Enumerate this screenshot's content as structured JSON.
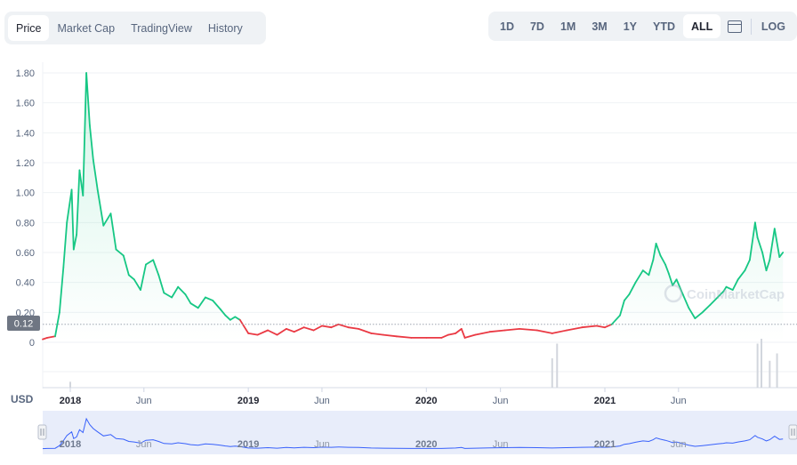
{
  "tabs": [
    "Price",
    "Market Cap",
    "TradingView",
    "History"
  ],
  "ranges": [
    "1D",
    "7D",
    "1M",
    "3M",
    "1Y",
    "YTD",
    "ALL"
  ],
  "log_label": "LOG",
  "currency_label": "USD",
  "watermark": "CoinMarketCap",
  "current_price_label": "0.12",
  "colors": {
    "up": "#16c784",
    "down": "#ea3943",
    "navigator": "#3861fb",
    "grid": "#eff2f5",
    "text": "#58667e"
  },
  "icons": {
    "calendar": "calendar-icon",
    "watermark_logo": "cmc-logo-icon"
  },
  "chart_data": {
    "type": "line",
    "title": "",
    "xlabel": "",
    "ylabel": "",
    "ylim": [
      0,
      1.8
    ],
    "yticks": [
      0,
      0.2,
      0.4,
      0.6,
      0.8,
      1.0,
      1.2,
      1.4,
      1.6,
      1.8
    ],
    "ytick_labels": [
      "0",
      "0.20",
      "0.40",
      "0.60",
      "0.80",
      "1.00",
      "1.20",
      "1.40",
      "1.60",
      "1.80"
    ],
    "xtick_labels": [
      "2018",
      "Jun",
      "2019",
      "Jun",
      "2020",
      "Jun",
      "2021",
      "Jun"
    ],
    "xtick_dates": [
      "2018-01-01",
      "2018-06-01",
      "2019-01-01",
      "2019-06-01",
      "2020-01-01",
      "2020-06-01",
      "2021-01-01",
      "2021-06-01"
    ],
    "reference_line": 0.12,
    "grid": true,
    "series": [
      {
        "x": [
          "2017-10-01",
          "2017-11-15",
          "2017-12-01",
          "2017-12-10",
          "2017-12-18",
          "2017-12-25",
          "2018-01-04",
          "2018-01-08",
          "2018-01-14",
          "2018-01-20",
          "2018-01-27",
          "2018-02-03",
          "2018-02-10",
          "2018-02-17",
          "2018-02-26",
          "2018-03-10",
          "2018-03-25",
          "2018-04-05",
          "2018-04-20",
          "2018-05-01",
          "2018-05-12",
          "2018-05-25",
          "2018-06-05",
          "2018-06-20",
          "2018-07-01",
          "2018-07-12",
          "2018-07-28",
          "2018-08-10",
          "2018-08-25",
          "2018-09-05",
          "2018-09-20",
          "2018-10-05",
          "2018-10-20",
          "2018-11-05",
          "2018-11-15",
          "2018-11-25",
          "2018-12-05",
          "2018-12-15",
          "2019-01-01",
          "2019-01-20",
          "2019-02-10",
          "2019-03-01",
          "2019-03-20",
          "2019-04-05",
          "2019-04-25",
          "2019-05-15",
          "2019-06-01",
          "2019-06-20",
          "2019-07-05",
          "2019-07-25",
          "2019-08-15",
          "2019-09-10",
          "2019-10-05",
          "2019-11-01",
          "2019-12-01",
          "2020-01-01",
          "2020-02-01",
          "2020-02-15",
          "2020-03-01",
          "2020-03-13",
          "2020-03-20",
          "2020-04-10",
          "2020-05-10",
          "2020-06-10",
          "2020-07-10",
          "2020-08-15",
          "2020-09-15",
          "2020-10-15",
          "2020-11-15",
          "2020-12-15",
          "2021-01-01",
          "2021-01-15",
          "2021-02-01",
          "2021-02-10",
          "2021-02-20",
          "2021-03-05",
          "2021-03-20",
          "2021-04-01",
          "2021-04-10",
          "2021-04-16",
          "2021-04-25",
          "2021-05-05",
          "2021-05-12",
          "2021-05-20",
          "2021-05-28",
          "2021-06-10",
          "2021-06-22",
          "2021-07-05",
          "2021-07-20",
          "2021-08-05",
          "2021-08-20",
          "2021-09-01",
          "2021-09-07",
          "2021-09-20",
          "2021-10-01",
          "2021-10-15",
          "2021-10-25",
          "2021-11-05",
          "2021-11-10",
          "2021-11-20",
          "2021-11-28",
          "2021-12-05",
          "2021-12-15",
          "2021-12-25",
          "2022-01-01"
        ],
        "y": [
          0.02,
          0.03,
          0.04,
          0.2,
          0.5,
          0.8,
          1.02,
          0.62,
          0.72,
          1.15,
          0.98,
          1.8,
          1.45,
          1.22,
          1.02,
          0.78,
          0.86,
          0.62,
          0.58,
          0.45,
          0.42,
          0.35,
          0.52,
          0.55,
          0.45,
          0.33,
          0.3,
          0.37,
          0.32,
          0.26,
          0.23,
          0.3,
          0.28,
          0.22,
          0.18,
          0.15,
          0.17,
          0.15,
          0.06,
          0.05,
          0.08,
          0.05,
          0.09,
          0.07,
          0.1,
          0.08,
          0.11,
          0.1,
          0.12,
          0.1,
          0.09,
          0.06,
          0.05,
          0.04,
          0.03,
          0.03,
          0.03,
          0.05,
          0.06,
          0.09,
          0.03,
          0.05,
          0.07,
          0.08,
          0.09,
          0.08,
          0.06,
          0.08,
          0.1,
          0.11,
          0.1,
          0.12,
          0.18,
          0.28,
          0.32,
          0.4,
          0.48,
          0.45,
          0.55,
          0.66,
          0.58,
          0.52,
          0.46,
          0.38,
          0.42,
          0.32,
          0.23,
          0.16,
          0.2,
          0.25,
          0.3,
          0.34,
          0.37,
          0.35,
          0.42,
          0.48,
          0.55,
          0.8,
          0.7,
          0.6,
          0.48,
          0.55,
          0.76,
          0.57,
          0.6
        ]
      }
    ],
    "volume_x": [
      "2018-01-01",
      "2020-09-15",
      "2020-09-25",
      "2021-11-10",
      "2021-11-18",
      "2021-12-05",
      "2021-12-20"
    ],
    "volume_values": [
      0.12,
      0.6,
      0.9,
      0.9,
      1.0,
      0.55,
      0.7
    ]
  }
}
